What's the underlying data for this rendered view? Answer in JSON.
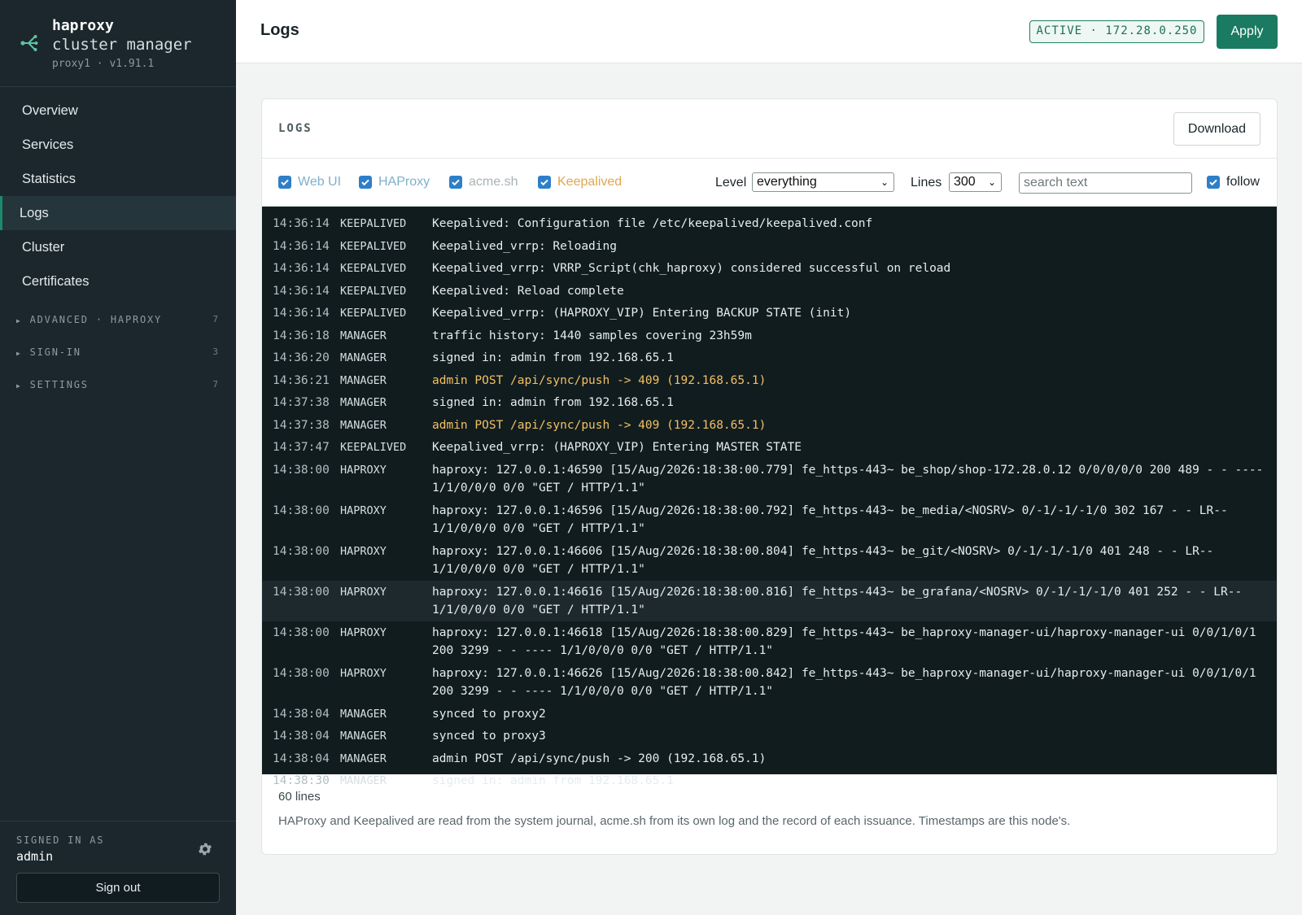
{
  "brand": {
    "name": "haproxy",
    "subtitle": "cluster manager",
    "version": "proxy1 · v1.91.1"
  },
  "sidebar": {
    "items": [
      {
        "label": "Overview"
      },
      {
        "label": "Services"
      },
      {
        "label": "Statistics"
      },
      {
        "label": "Logs",
        "active": true
      },
      {
        "label": "Cluster"
      },
      {
        "label": "Certificates"
      }
    ],
    "groups": [
      {
        "label": "ADVANCED · HAPROXY",
        "count": "7"
      },
      {
        "label": "SIGN-IN",
        "count": "3"
      },
      {
        "label": "SETTINGS",
        "count": "7"
      }
    ],
    "signed_in_label": "SIGNED IN AS",
    "user": "admin",
    "sign_out": "Sign out",
    "settings_icon": "gear-icon"
  },
  "header": {
    "title": "Logs",
    "status": "ACTIVE · 172.28.0.250",
    "apply": "Apply"
  },
  "card": {
    "title": "LOGS",
    "download": "Download",
    "sources": [
      {
        "label": "Web UI",
        "checked": true,
        "color": "#7fb0c8"
      },
      {
        "label": "HAProxy",
        "checked": true,
        "color": "#7fb0c8"
      },
      {
        "label": "acme.sh",
        "checked": true,
        "color": "#a8b2b6"
      },
      {
        "label": "Keepalived",
        "checked": true,
        "color": "#e0a64e"
      }
    ],
    "level_label": "Level",
    "level_value": "everything",
    "lines_label": "Lines",
    "lines_value": "300",
    "search_placeholder": "search text",
    "follow_label": "follow",
    "follow_checked": true,
    "footer_count": "60 lines",
    "footer_note": "HAProxy and Keepalived are read from the system journal, acme.sh from its own log and the record of each issuance. Timestamps are this node's."
  },
  "logs": [
    {
      "time": "14:36:14",
      "source": "KEEPALIVED",
      "msg": "Keepalived: Configuration file /etc/keepalived/keepalived.conf"
    },
    {
      "time": "14:36:14",
      "source": "KEEPALIVED",
      "msg": "Keepalived_vrrp: Reloading"
    },
    {
      "time": "14:36:14",
      "source": "KEEPALIVED",
      "msg": "Keepalived_vrrp: VRRP_Script(chk_haproxy) considered successful on reload"
    },
    {
      "time": "14:36:14",
      "source": "KEEPALIVED",
      "msg": "Keepalived: Reload complete"
    },
    {
      "time": "14:36:14",
      "source": "KEEPALIVED",
      "msg": "Keepalived_vrrp: (HAPROXY_VIP) Entering BACKUP STATE (init)"
    },
    {
      "time": "14:36:18",
      "source": "MANAGER",
      "msg": "traffic history: 1440 samples covering 23h59m"
    },
    {
      "time": "14:36:20",
      "source": "MANAGER",
      "msg": "signed in: admin from 192.168.65.1"
    },
    {
      "time": "14:36:21",
      "source": "MANAGER",
      "msg": "admin POST /api/sync/push -> 409 (192.168.65.1)",
      "warn": true
    },
    {
      "time": "14:37:38",
      "source": "MANAGER",
      "msg": "signed in: admin from 192.168.65.1"
    },
    {
      "time": "14:37:38",
      "source": "MANAGER",
      "msg": "admin POST /api/sync/push -> 409 (192.168.65.1)",
      "warn": true
    },
    {
      "time": "14:37:47",
      "source": "KEEPALIVED",
      "msg": "Keepalived_vrrp: (HAPROXY_VIP) Entering MASTER STATE"
    },
    {
      "time": "14:38:00",
      "source": "HAPROXY",
      "msg": "haproxy: 127.0.0.1:46590 [15/Aug/2026:18:38:00.779] fe_https-443~ be_shop/shop-172.28.0.12 0/0/0/0/0 200 489 - - ---- 1/1/0/0/0 0/0 \"GET / HTTP/1.1\""
    },
    {
      "time": "14:38:00",
      "source": "HAPROXY",
      "msg": "haproxy: 127.0.0.1:46596 [15/Aug/2026:18:38:00.792] fe_https-443~ be_media/<NOSRV> 0/-1/-1/-1/0 302 167 - - LR-- 1/1/0/0/0 0/0 \"GET / HTTP/1.1\""
    },
    {
      "time": "14:38:00",
      "source": "HAPROXY",
      "msg": "haproxy: 127.0.0.1:46606 [15/Aug/2026:18:38:00.804] fe_https-443~ be_git/<NOSRV> 0/-1/-1/-1/0 401 248 - - LR-- 1/1/0/0/0 0/0 \"GET / HTTP/1.1\""
    },
    {
      "time": "14:38:00",
      "source": "HAPROXY",
      "msg": "haproxy: 127.0.0.1:46616 [15/Aug/2026:18:38:00.816] fe_https-443~ be_grafana/<NOSRV> 0/-1/-1/-1/0 401 252 - - LR-- 1/1/0/0/0 0/0 \"GET / HTTP/1.1\"",
      "highlight": true
    },
    {
      "time": "14:38:00",
      "source": "HAPROXY",
      "msg": "haproxy: 127.0.0.1:46618 [15/Aug/2026:18:38:00.829] fe_https-443~ be_haproxy-manager-ui/haproxy-manager-ui 0/0/1/0/1 200 3299 - - ---- 1/1/0/0/0 0/0 \"GET / HTTP/1.1\""
    },
    {
      "time": "14:38:00",
      "source": "HAPROXY",
      "msg": "haproxy: 127.0.0.1:46626 [15/Aug/2026:18:38:00.842] fe_https-443~ be_haproxy-manager-ui/haproxy-manager-ui 0/0/1/0/1 200 3299 - - ---- 1/1/0/0/0 0/0 \"GET / HTTP/1.1\""
    },
    {
      "time": "14:38:04",
      "source": "MANAGER",
      "msg": "synced to proxy2"
    },
    {
      "time": "14:38:04",
      "source": "MANAGER",
      "msg": "synced to proxy3"
    },
    {
      "time": "14:38:04",
      "source": "MANAGER",
      "msg": "admin POST /api/sync/push -> 200 (192.168.65.1)"
    },
    {
      "time": "14:38:30",
      "source": "MANAGER",
      "msg": "signed in: admin from 192.168.65.1"
    }
  ]
}
